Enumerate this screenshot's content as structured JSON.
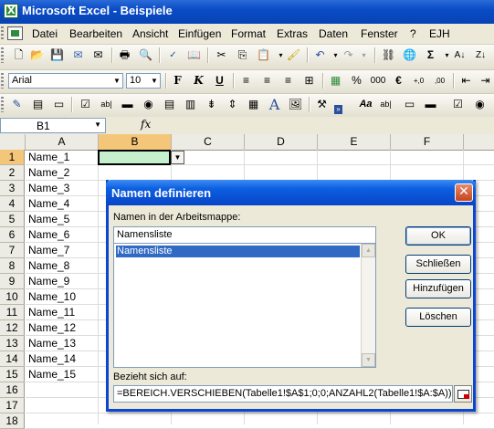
{
  "window": {
    "title": "Microsoft Excel - Beispiele"
  },
  "menu": {
    "items": [
      "Datei",
      "Bearbeiten",
      "Ansicht",
      "Einfügen",
      "Format",
      "Extras",
      "Daten",
      "Fenster",
      "?",
      "EJH"
    ]
  },
  "toolbar_format": {
    "font": "Arial",
    "size": "10",
    "percent": "%",
    "thousands": "000",
    "euro": "€"
  },
  "toolbar_standard": {
    "sigma": "Σ"
  },
  "formula_bar": {
    "name_box": "B1",
    "fx": "fx"
  },
  "grid": {
    "columns": [
      "A",
      "B",
      "C",
      "D",
      "E",
      "F"
    ],
    "selected_column": "B",
    "selected_row": "1",
    "rows": [
      "1",
      "2",
      "3",
      "4",
      "5",
      "6",
      "7",
      "8",
      "9",
      "10",
      "11",
      "12",
      "13",
      "14",
      "15",
      "16",
      "17",
      "18"
    ],
    "col_a_values": [
      "Name_1",
      "Name_2",
      "Name_3",
      "Name_4",
      "Name_5",
      "Name_6",
      "Name_7",
      "Name_8",
      "Name_9",
      "Name_10",
      "Name_11",
      "Name_12",
      "Name_13",
      "Name_14",
      "Name_15",
      "",
      "",
      ""
    ],
    "active_cell_color": "#c6efce"
  },
  "dialog": {
    "title": "Namen definieren",
    "names_label": "Namen in der Arbeitsmappe:",
    "name_value": "Namensliste",
    "list_items": [
      "Namensliste"
    ],
    "refers_label": "Bezieht sich auf:",
    "refers_value": "=BEREICH.VERSCHIEBEN(Tabelle1!$A$1;0;0;ANZAHL2(Tabelle1!$A:$A))",
    "buttons": {
      "ok": "OK",
      "close": "Schließen",
      "add": "Hinzufügen",
      "delete": "Löschen"
    }
  },
  "colors": {
    "titlebar": "#0a4cc6",
    "dialog_border": "#0a46d2",
    "selection_header": "#f3c67a",
    "list_selection": "#316ac5"
  }
}
